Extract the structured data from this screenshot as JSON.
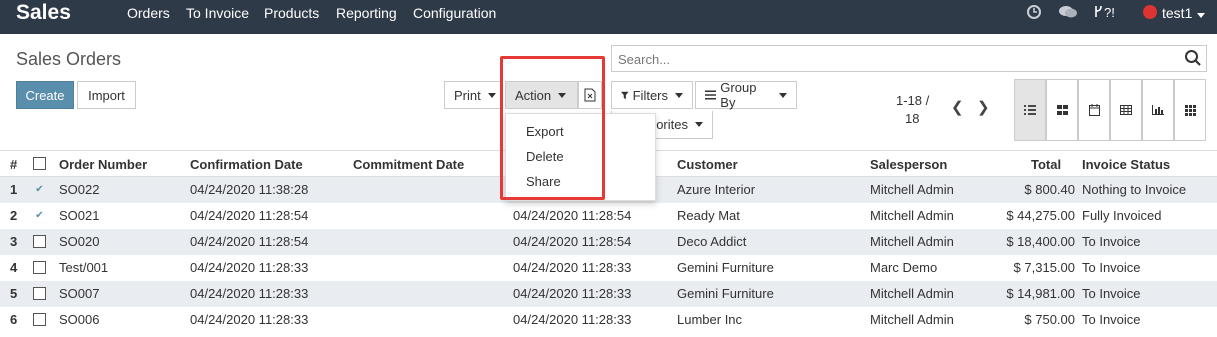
{
  "app": {
    "brand": "Sales"
  },
  "nav": {
    "items": [
      "Orders",
      "To Invoice",
      "Products",
      "Reporting",
      "Configuration"
    ]
  },
  "systray": {
    "debug_label": "?!",
    "user": "test1"
  },
  "page": {
    "title": "Sales Orders"
  },
  "search": {
    "placeholder": "Search..."
  },
  "buttons": {
    "create": "Create",
    "import": "Import",
    "print": "Print",
    "action": "Action",
    "filters": "Filters",
    "group_by": "Group By",
    "favorites_partial": "orites"
  },
  "pager": {
    "line1": "1-18 /",
    "line2": "18"
  },
  "action_menu": {
    "items": [
      "Export",
      "Delete",
      "Share"
    ]
  },
  "table": {
    "columns": [
      "#",
      "Order Number",
      "Confirmation Date",
      "Commitment Date",
      "Customer",
      "Salesperson",
      "Total",
      "Invoice Status"
    ],
    "rows": [
      {
        "n": "1",
        "checked": true,
        "order": "SO022",
        "confirm": "04/24/2020 11:38:28",
        "commit": "",
        "customer": "Azure Interior",
        "salesperson": "Mitchell Admin",
        "total": "$ 800.40",
        "status": "Nothing to Invoice"
      },
      {
        "n": "2",
        "checked": true,
        "order": "SO021",
        "confirm": "04/24/2020 11:28:54",
        "commit": "04/24/2020 11:28:54",
        "customer": "Ready Mat",
        "salesperson": "Mitchell Admin",
        "total": "$ 44,275.00",
        "status": "Fully Invoiced"
      },
      {
        "n": "3",
        "checked": false,
        "order": "SO020",
        "confirm": "04/24/2020 11:28:54",
        "commit": "04/24/2020 11:28:54",
        "customer": "Deco Addict",
        "salesperson": "Mitchell Admin",
        "total": "$ 18,400.00",
        "status": "To Invoice"
      },
      {
        "n": "4",
        "checked": false,
        "order": "Test/001",
        "confirm": "04/24/2020 11:28:33",
        "commit": "04/24/2020 11:28:33",
        "customer": "Gemini Furniture",
        "salesperson": "Marc Demo",
        "total": "$ 7,315.00",
        "status": "To Invoice"
      },
      {
        "n": "5",
        "checked": false,
        "order": "SO007",
        "confirm": "04/24/2020 11:28:33",
        "commit": "04/24/2020 11:28:33",
        "customer": "Gemini Furniture",
        "salesperson": "Mitchell Admin",
        "total": "$ 14,981.00",
        "status": "To Invoice"
      },
      {
        "n": "6",
        "checked": false,
        "order": "SO006",
        "confirm": "04/24/2020 11:28:33",
        "commit": "04/24/2020 11:28:33",
        "customer": "Lumber Inc",
        "salesperson": "Mitchell Admin",
        "total": "$ 750.00",
        "status": "To Invoice"
      }
    ]
  },
  "colors": {
    "topbar": "#2f3a49",
    "primary": "#5a8ead",
    "highlight": "#e53935",
    "row_alt": "#e9ecf0"
  }
}
